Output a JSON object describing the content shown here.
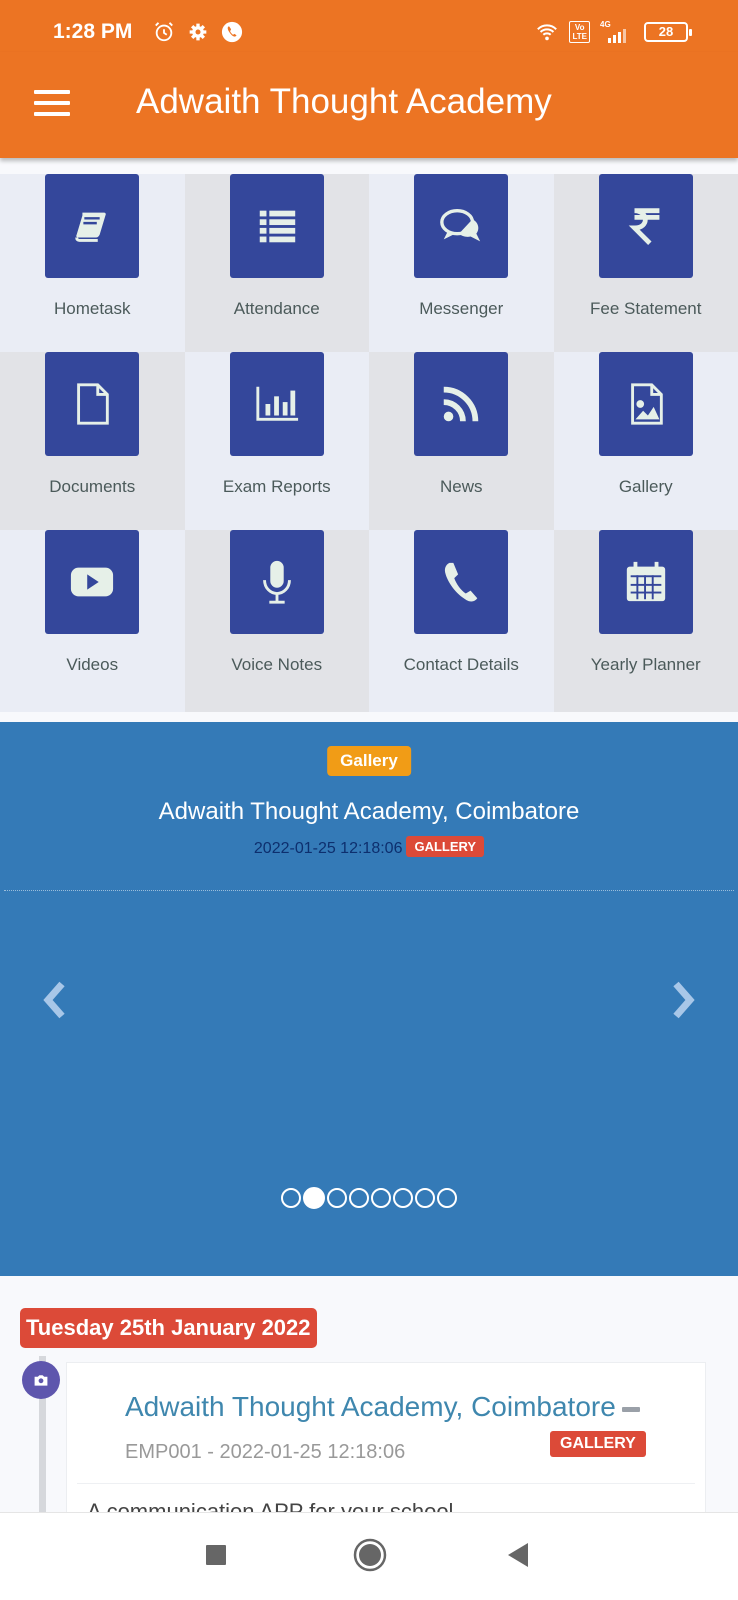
{
  "status_bar": {
    "time": "1:28 PM",
    "left_icons": [
      "alarm-icon",
      "gear-icon",
      "phone-call-icon"
    ],
    "right_icons": [
      "wifi-icon",
      "volte-icon",
      "signal-icon",
      "battery-icon"
    ],
    "volte_label_top": "Vo",
    "volte_label_bottom": "LTE",
    "network_type": "4G",
    "battery_level": "28"
  },
  "app_bar": {
    "title": "Adwaith Thought Academy",
    "menu_icon": "hamburger-menu-icon"
  },
  "colors": {
    "brand": "#ec7423",
    "tile": "#34479b",
    "carousel_bg": "#347ab7",
    "category_badge": "#f19c16",
    "danger_badge": "#dc4a38",
    "timeline_icon": "#5e56ad",
    "timeline_title": "#3f87ae"
  },
  "menu_grid": [
    {
      "label": "Hometask",
      "icon": "book-icon"
    },
    {
      "label": "Attendance",
      "icon": "list-icon"
    },
    {
      "label": "Messenger",
      "icon": "chat-bubbles-icon"
    },
    {
      "label": "Fee Statement",
      "icon": "rupee-icon"
    },
    {
      "label": "Documents",
      "icon": "document-icon"
    },
    {
      "label": "Exam Reports",
      "icon": "bar-chart-icon"
    },
    {
      "label": "News",
      "icon": "rss-icon"
    },
    {
      "label": "Gallery",
      "icon": "image-file-icon"
    },
    {
      "label": "Videos",
      "icon": "video-play-icon"
    },
    {
      "label": "Voice Notes",
      "icon": "microphone-icon"
    },
    {
      "label": "Contact Details",
      "icon": "phone-icon"
    },
    {
      "label": "Yearly Planner",
      "icon": "calendar-icon"
    }
  ],
  "carousel": {
    "category": "Gallery",
    "title": "Adwaith Thought Academy, Coimbatore",
    "timestamp": "2022-01-25 12:18:06",
    "type_badge": "GALLERY",
    "slide_count": 8,
    "active_slide": 2,
    "prev_icon": "chevron-left-icon",
    "next_icon": "chevron-right-icon"
  },
  "timeline": {
    "date": "Tuesday 25th January 2022",
    "entry": {
      "icon": "camera-icon",
      "title": "Adwaith Thought Academy, Coimbatore",
      "meta": "EMP001 - 2022-01-25 12:18:06",
      "badge": "GALLERY",
      "body": "A communication APP for your school"
    }
  },
  "nav_bar": {
    "buttons": [
      "recents-button",
      "home-button",
      "back-button"
    ]
  }
}
